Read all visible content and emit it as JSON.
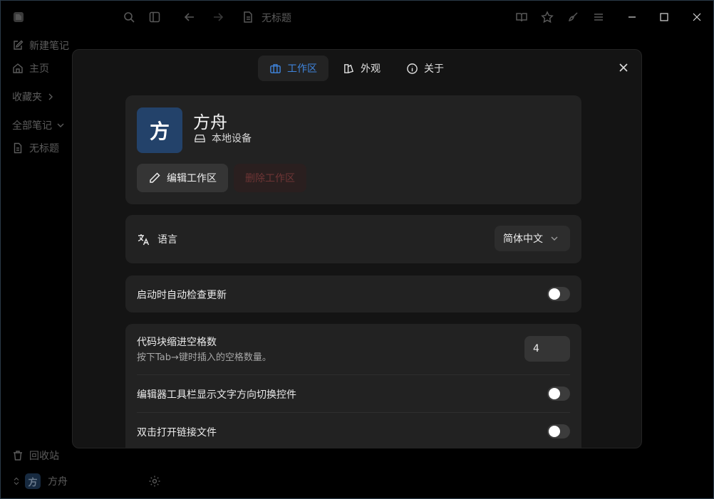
{
  "app": {
    "title": "无标题",
    "sidebar": {
      "new_note": "新建笔记",
      "home": "主页",
      "favorites": "收藏夹",
      "all_notes": "全部笔记",
      "untitled": "无标题",
      "trash": "回收站",
      "workspace_initial": "方",
      "workspace_name": "方舟"
    }
  },
  "settings": {
    "tabs": [
      {
        "label": "工作区",
        "active": true
      },
      {
        "label": "外观",
        "active": false
      },
      {
        "label": "关于",
        "active": false
      }
    ],
    "workspace": {
      "initial": "方",
      "name": "方舟",
      "device": "本地设备",
      "edit_label": "编辑工作区",
      "delete_label": "删除工作区"
    },
    "language": {
      "label": "语言",
      "value": "简体中文"
    },
    "auto_update": {
      "label": "启动时自动检查更新",
      "enabled": false
    },
    "code_indent": {
      "label": "代码块缩进空格数",
      "description": "按下Tab→键时插入的空格数量。",
      "value": "4"
    },
    "text_direction": {
      "label": "编辑器工具栏显示文字方向切换控件",
      "enabled": false
    },
    "double_click": {
      "label": "双击打开链接文件",
      "enabled": false
    }
  },
  "colors": {
    "accent": "#3f84dc",
    "avatar": "#23426a",
    "danger_text": "#6e3535"
  }
}
